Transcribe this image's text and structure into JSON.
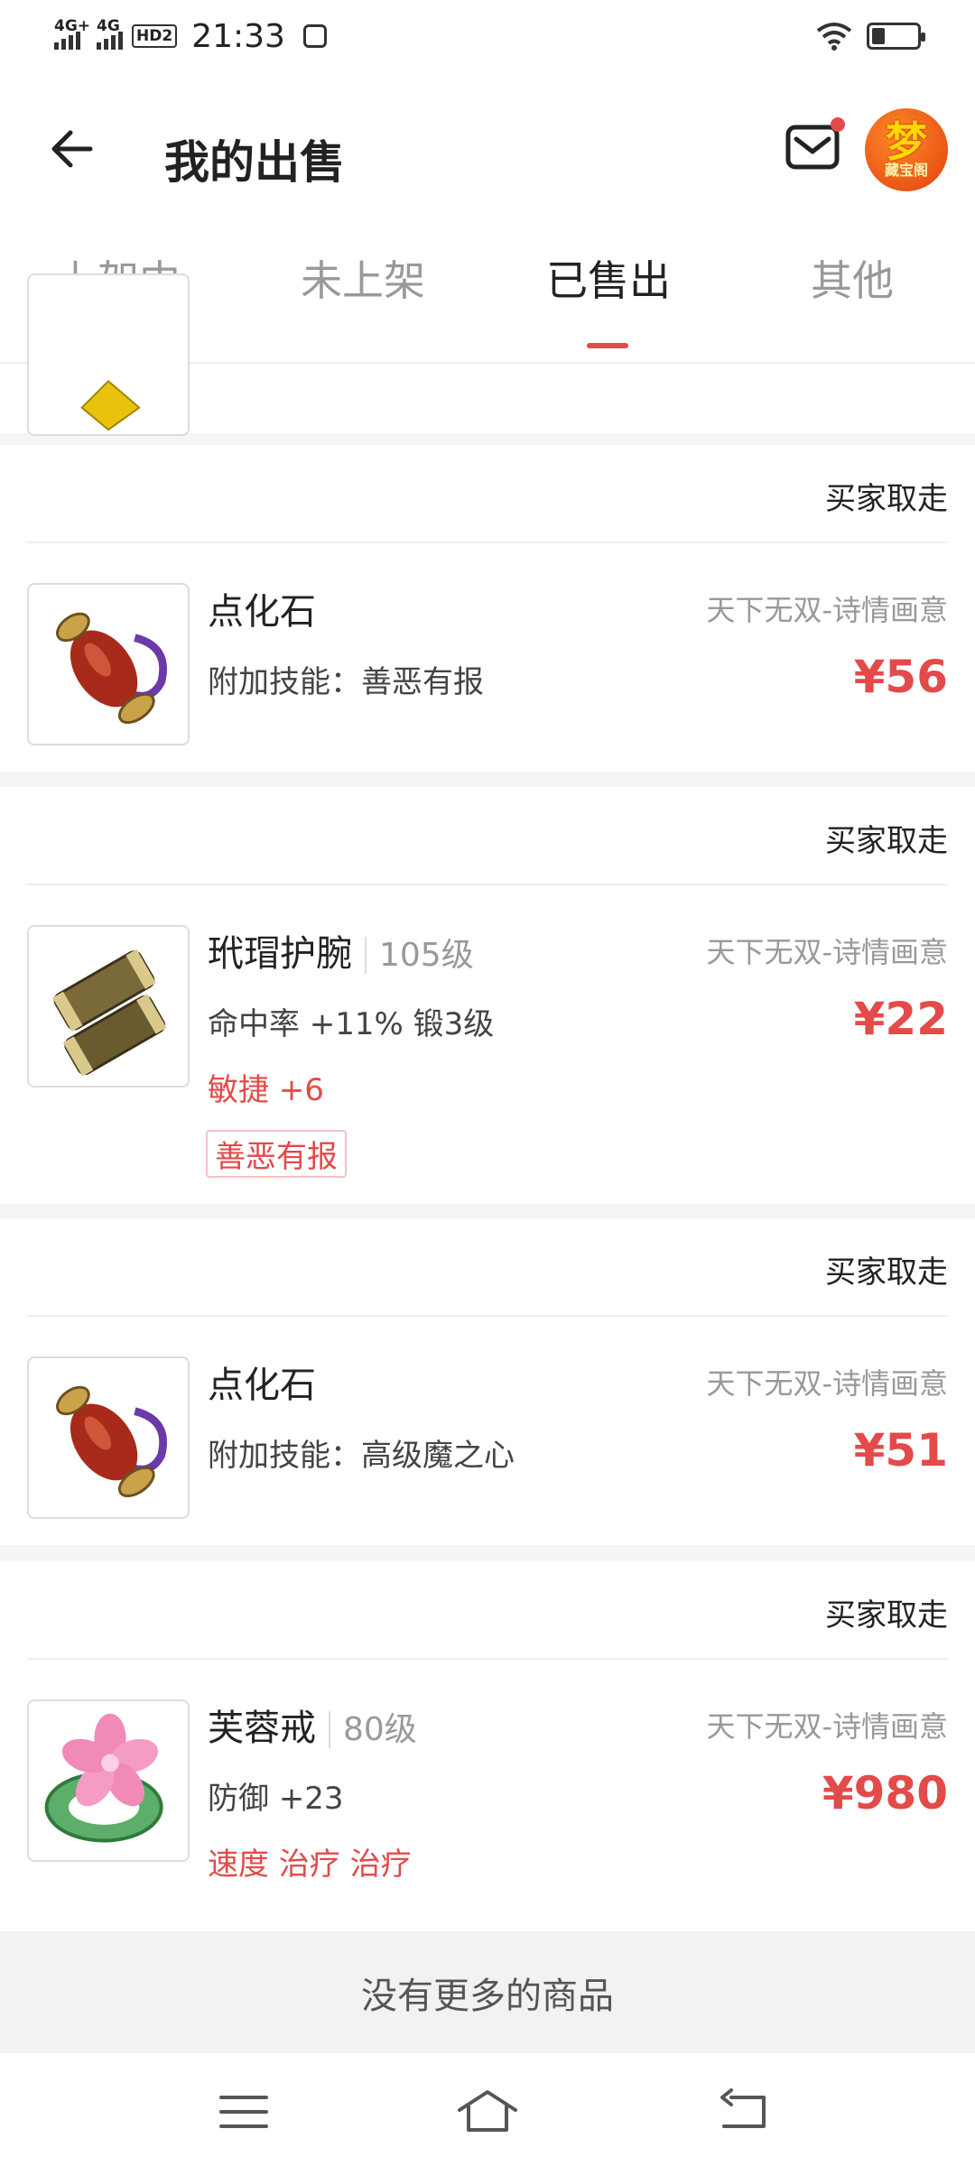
{
  "status_bar": {
    "net1": "4G+",
    "net2": "4G",
    "hd": "HD2",
    "time": "21:33",
    "battery_level": 0.3
  },
  "header": {
    "title": "我的出售",
    "avatar_text": "梦",
    "avatar_subtext": "藏宝阁",
    "mail_icon": "mail-icon"
  },
  "tabs": [
    {
      "label": "上架中"
    },
    {
      "label": "未上架"
    },
    {
      "label": "已售出"
    },
    {
      "label": "其他"
    }
  ],
  "active_tab": "已售出",
  "items": [
    {
      "status": "买家取走",
      "name": "点化石",
      "server": "天下无双-诗情画意",
      "attr1": "附加技能：善恶有报",
      "price": "¥56",
      "icon": "potion-icon"
    },
    {
      "status": "买家取走",
      "name": "玳瑁护腕",
      "level": "105级",
      "server": "天下无双-诗情画意",
      "attr1": "命中率 +11% 锻3级",
      "attr2": "敏捷 +6",
      "tag": "善恶有报",
      "price": "¥22",
      "icon": "bracer-icon"
    },
    {
      "status": "买家取走",
      "name": "点化石",
      "server": "天下无双-诗情画意",
      "attr1": "附加技能：高级魔之心",
      "price": "¥51",
      "icon": "potion-icon"
    },
    {
      "status": "买家取走",
      "name": "芙蓉戒",
      "level": "80级",
      "server": "天下无双-诗情画意",
      "attr1": "防御 +23",
      "attr2": "速度 治疗 治疗",
      "price": "¥980",
      "icon": "flower-ring-icon"
    }
  ],
  "footer_text": "没有更多的商品",
  "nav": [
    "menu-icon",
    "home-icon",
    "back-nav-icon"
  ]
}
